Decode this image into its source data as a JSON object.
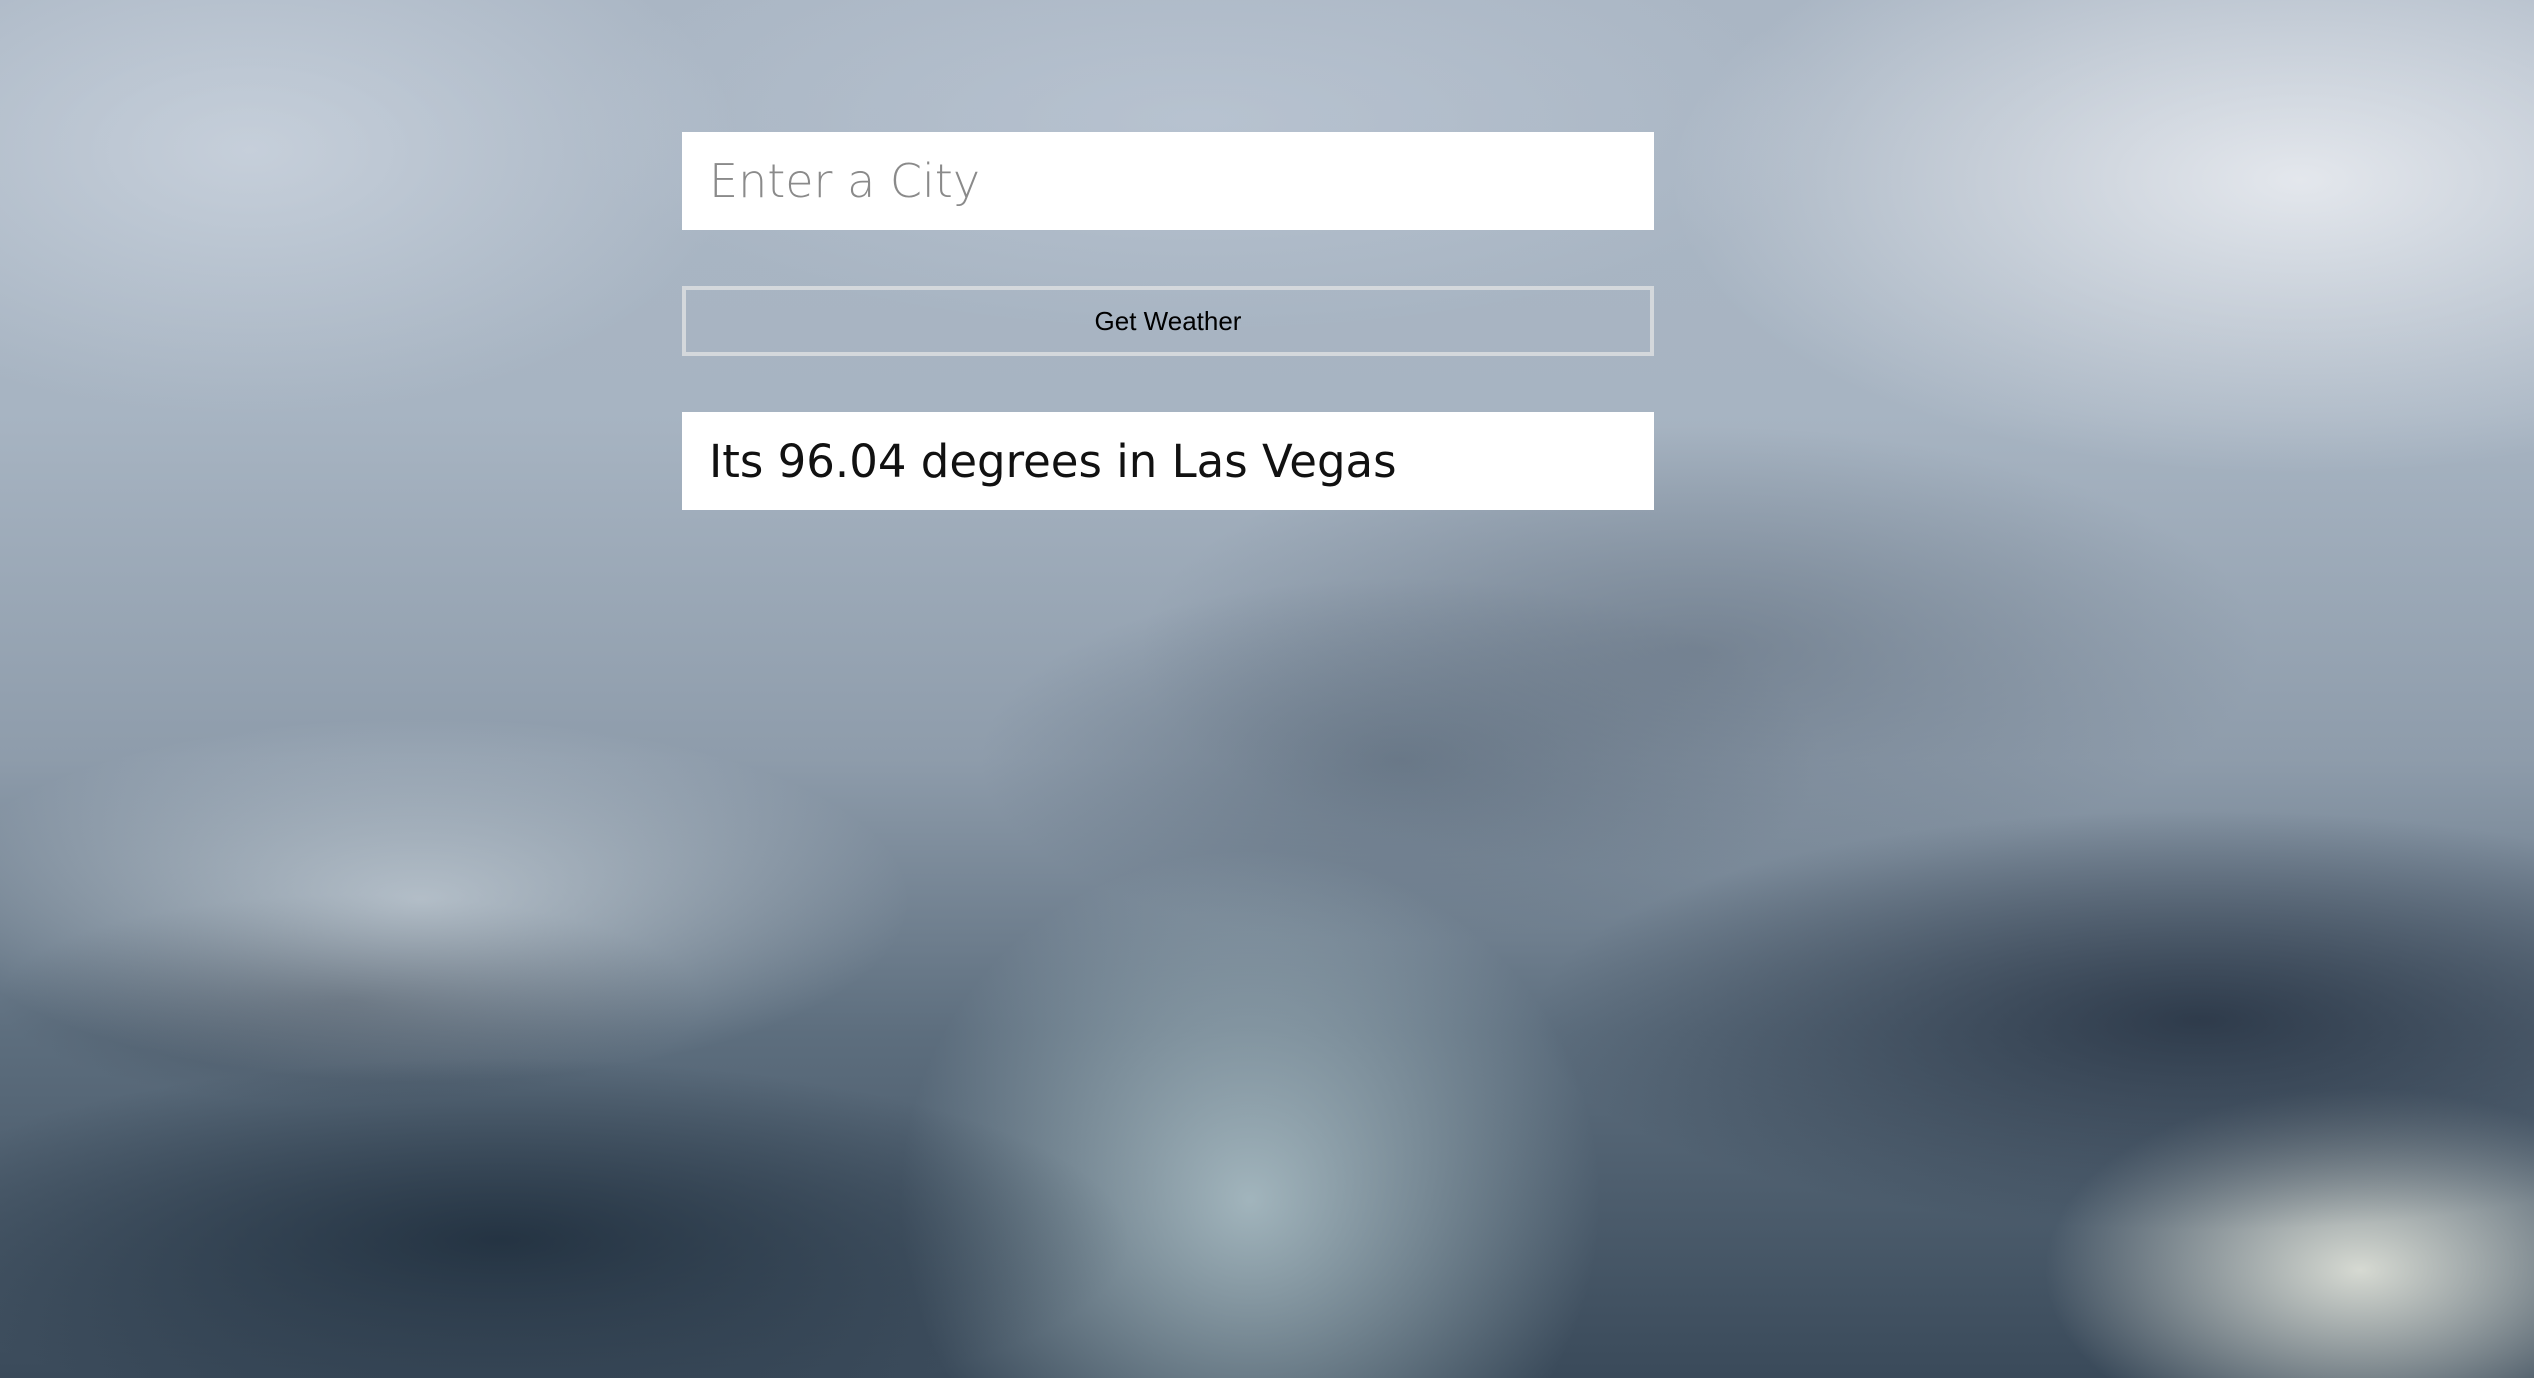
{
  "search": {
    "placeholder": "Enter a City",
    "value": ""
  },
  "actions": {
    "get_weather_label": "Get Weather"
  },
  "result": {
    "text": "Its 96.04 degrees in Las Vegas"
  }
}
